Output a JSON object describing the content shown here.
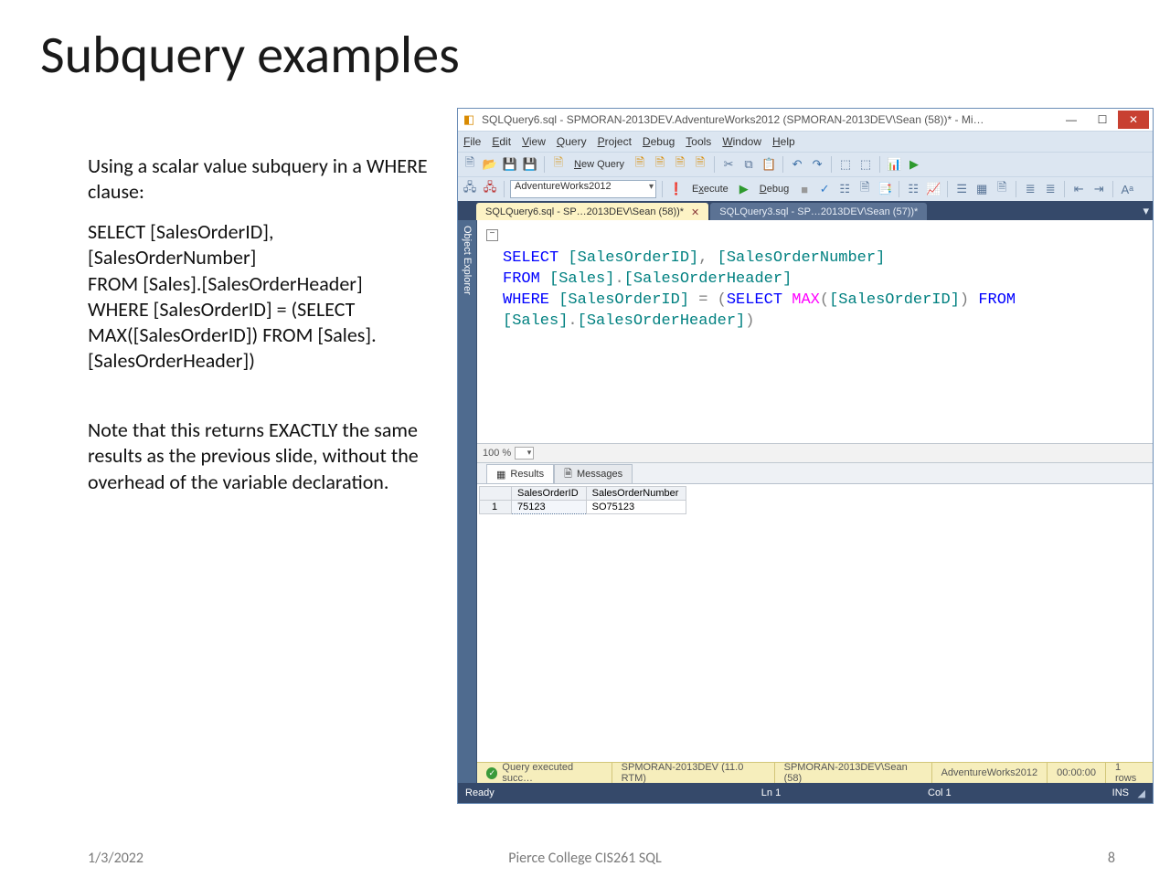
{
  "slide": {
    "title": "Subquery examples",
    "p1": "Using a scalar value subquery in a WHERE clause:",
    "code": "SELECT [SalesOrderID], [SalesOrderNumber]\nFROM [Sales].[SalesOrderHeader]\nWHERE [SalesOrderID] = (SELECT MAX([SalesOrderID]) FROM [Sales].[SalesOrderHeader])",
    "p2": "Note that this returns EXACTLY the same results as the previous slide, without the overhead of the variable declaration."
  },
  "footer": {
    "date": "1/3/2022",
    "center": "Pierce College CIS261 SQL",
    "page": "8"
  },
  "ssms": {
    "windowTitle": "SQLQuery6.sql - SPMORAN-2013DEV.AdventureWorks2012 (SPMORAN-2013DEV\\Sean (58))* - Mi…",
    "menus": [
      "File",
      "Edit",
      "View",
      "Query",
      "Project",
      "Debug",
      "Tools",
      "Window",
      "Help"
    ],
    "toolbar": {
      "newQuery": "New Query",
      "database": "AdventureWorks2012",
      "execute": "Execute",
      "debug": "Debug"
    },
    "tabs": [
      {
        "label": "SQLQuery6.sql - SP…2013DEV\\Sean (58))*",
        "active": true
      },
      {
        "label": "SQLQuery3.sql - SP…2013DEV\\Sean (57))*",
        "active": false
      }
    ],
    "sidePanel": "Object Explorer",
    "zoom": "100 %",
    "resultsTabs": {
      "results": "Results",
      "messages": "Messages"
    },
    "grid": {
      "columns": [
        "SalesOrderID",
        "SalesOrderNumber"
      ],
      "rows": [
        {
          "n": "1",
          "SalesOrderID": "75123",
          "SalesOrderNumber": "SO75123"
        }
      ]
    },
    "status": {
      "msg": "Query executed succ…",
      "server": "SPMORAN-2013DEV (11.0 RTM)",
      "user": "SPMORAN-2013DEV\\Sean (58)",
      "db": "AdventureWorks2012",
      "time": "00:00:00",
      "rows": "1 rows"
    },
    "footer": {
      "ready": "Ready",
      "ln": "Ln 1",
      "col": "Col 1",
      "ins": "INS"
    },
    "sql": {
      "l1_kw_select": "SELECT",
      "l1_c1": " [SalesOrderID]",
      "l1_comma": ",",
      "l1_c2": " [SalesOrderNumber]",
      "l2_kw_from": "FROM",
      "l2_tbl": " [Sales]",
      "l2_dot": ".",
      "l2_tbl2": "[SalesOrderHeader]",
      "l3_kw_where": "WHERE",
      "l3_col": " [SalesOrderID] ",
      "l3_eq": "=",
      "l3_open": " (",
      "l3_kw_select2": "SELECT",
      "l3_sp": " ",
      "l3_fn_max": "MAX",
      "l3_open2": "(",
      "l3_arg": "[SalesOrderID]",
      "l3_close2": ")",
      "l3_sp2": " ",
      "l3_kw_from2": "FROM",
      "l4_tbl": "[Sales]",
      "l4_dot": ".",
      "l4_tbl2": "[SalesOrderHeader]",
      "l4_close": ")"
    }
  }
}
